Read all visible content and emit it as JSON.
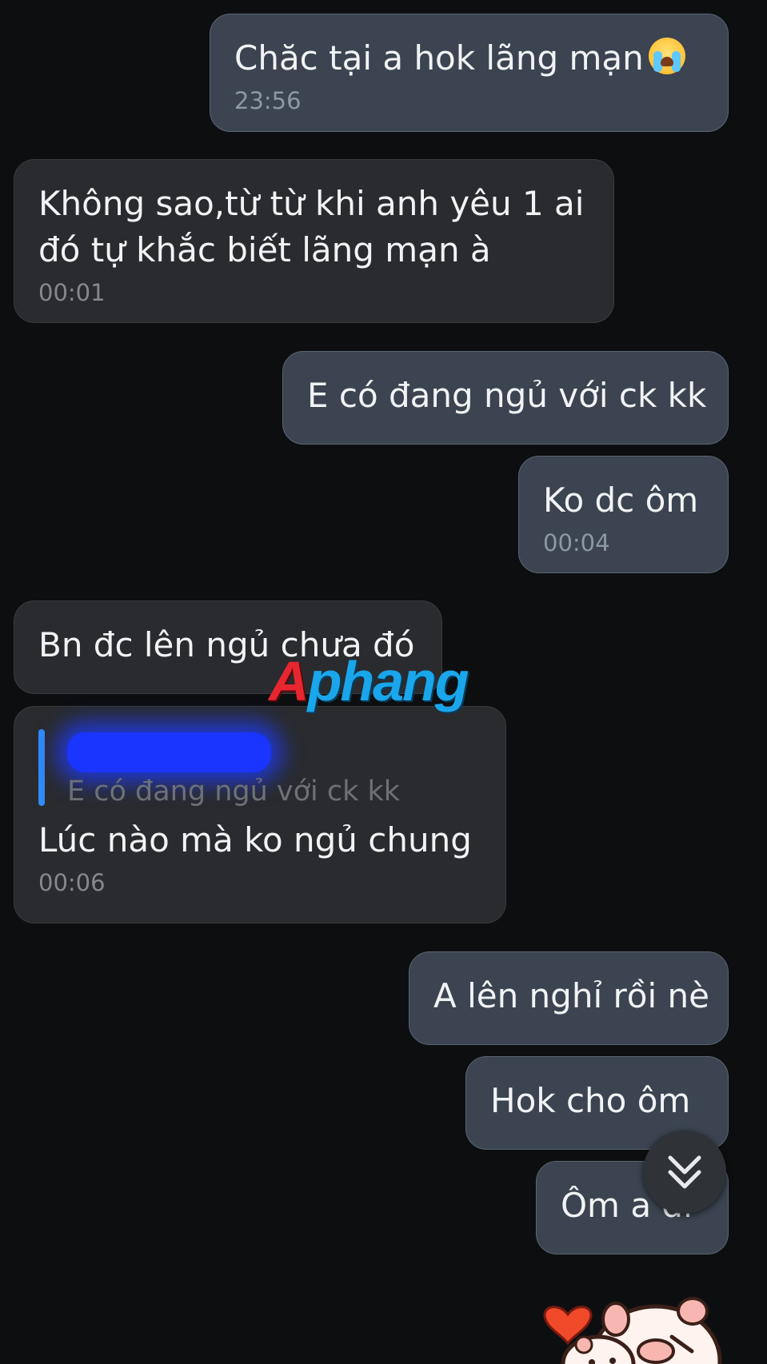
{
  "messages": [
    {
      "text": "Chăc tại a hok lãng mạn",
      "emoji": "crying-face-emoji",
      "time": "23:56"
    },
    {
      "text": "Không sao,từ từ khi anh yêu 1 ai đó tự khắc biết lãng mạn à",
      "time": "00:01"
    },
    {
      "text": "E có đang ngủ với ck kk"
    },
    {
      "text": "Ko dc ôm",
      "time": "00:04"
    },
    {
      "text": "Bn đc lên ngủ chưa đó"
    },
    {
      "reply_to": "E có đang ngủ với ck kk",
      "text": "Lúc nào mà ko ngủ chung",
      "time": "00:06"
    },
    {
      "text": "A lên nghỉ rồi nè"
    },
    {
      "text": "Hok cho ôm"
    },
    {
      "text": "Ôm a đi"
    }
  ],
  "watermark": {
    "part1": "A",
    "part2": "phang"
  },
  "scroll_button": {
    "icon": "double-chevron-down-icon"
  },
  "colors": {
    "background": "#0d0e10",
    "outgoing_bubble": "#3b4450",
    "incoming_bubble": "#2a2b2e",
    "reply_bar": "#2f8bf7"
  }
}
